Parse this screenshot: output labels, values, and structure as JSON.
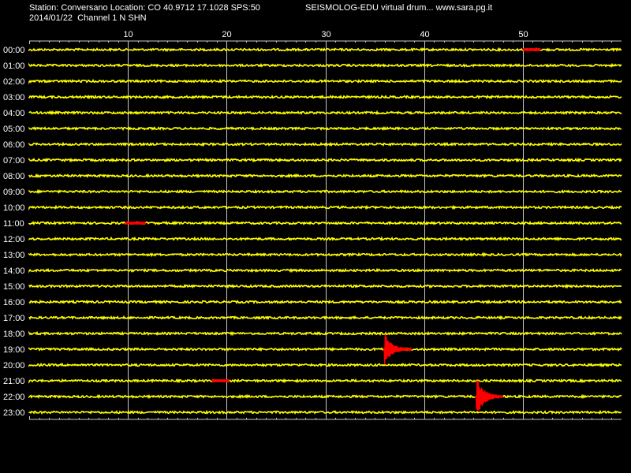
{
  "header": {
    "station_line": "Station: Conversano Location: CO 40.9712 17.1028 SPS:50",
    "credit_line": "SEISMOLOG-EDU virtual drum... www.sara.pg.it",
    "date_line": "2014/01/22  Channel 1 N SHN"
  },
  "colors": {
    "background": "#000000",
    "trace": "#ffff00",
    "event": "#ff0000",
    "grid": "#c8c8c8",
    "text": "#ffffff"
  },
  "chart_data": {
    "type": "line",
    "title": "",
    "xlabel": "",
    "ylabel": "",
    "x_unit": "minutes",
    "xlim": [
      0,
      60
    ],
    "x_ticks": [
      10,
      20,
      30,
      40,
      50
    ],
    "grid": true,
    "rows": [
      "00:00",
      "01:00",
      "02:00",
      "03:00",
      "04:00",
      "05:00",
      "06:00",
      "07:00",
      "08:00",
      "09:00",
      "10:00",
      "11:00",
      "12:00",
      "13:00",
      "14:00",
      "15:00",
      "16:00",
      "17:00",
      "18:00",
      "19:00",
      "20:00",
      "21:00",
      "22:00",
      "23:00"
    ],
    "events": [
      {
        "row": "00:00",
        "start_min": 50.0,
        "end_min": 51.8,
        "kind": "segment"
      },
      {
        "row": "11:00",
        "start_min": 9.7,
        "end_min": 11.8,
        "kind": "segment"
      },
      {
        "row": "19:00",
        "start_min": 35.9,
        "end_min": 38.7,
        "kind": "quake",
        "amplitude": 1.0
      },
      {
        "row": "21:00",
        "start_min": 18.5,
        "end_min": 20.3,
        "kind": "segment"
      },
      {
        "row": "22:00",
        "start_min": 45.2,
        "end_min": 48.0,
        "kind": "quake",
        "amplitude": 1.3
      }
    ]
  }
}
